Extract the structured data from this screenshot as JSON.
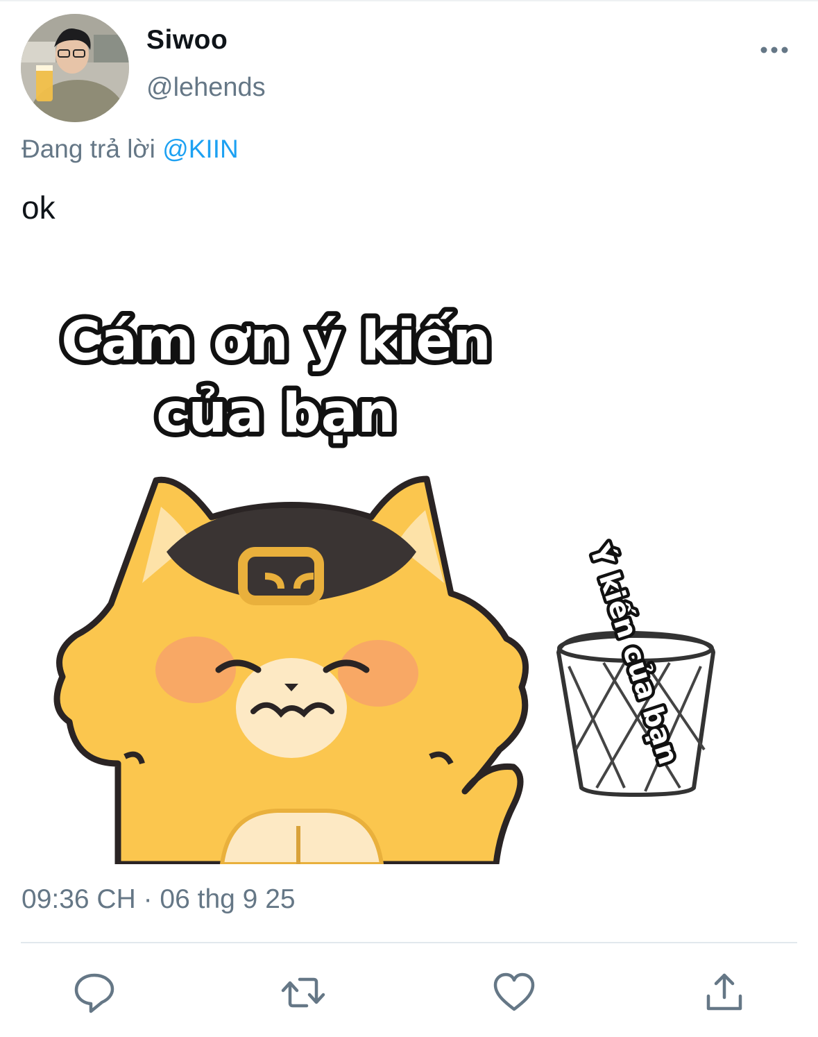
{
  "tweet": {
    "author_name": "Siwoo",
    "author_handle": "@lehends",
    "reply_prefix": "Đang trả lời",
    "reply_mention": "@KIIN",
    "text": "ok",
    "timestamp": "09:36 CH · 06 thg 9 25"
  },
  "media": {
    "caption_line1": "Cám ơn ý kiến",
    "caption_line2": "của bạn",
    "bin_label": "Ý kiến của bạn"
  },
  "icons": {
    "more": "more-dots-icon",
    "reply": "reply-icon",
    "retweet": "retweet-icon",
    "like": "heart-icon",
    "share": "share-icon"
  },
  "colors": {
    "link": "#1da1f2",
    "secondary_text": "#657786",
    "icon": "#657786",
    "cat_body": "#fbc64e",
    "cat_cap": "#3a3433",
    "cheeks": "#f7a26a"
  }
}
